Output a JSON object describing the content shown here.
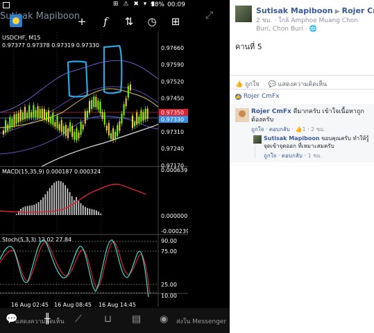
{
  "status_bar": {
    "time": "00:09",
    "battery": "98%",
    "icons": "⊞ ⚠ ✖ ▾ ▮"
  },
  "toolbar": {
    "account_name": "Sutisak Mapiboon",
    "tool_crosshair": "+",
    "tool_indicator": "f",
    "tool_objects": "⇅",
    "tool_timeframe": "◷",
    "tool_new_order": "⊞"
  },
  "chart": {
    "price_panel": {
      "symbol_label": "USDCHF, M15",
      "ohlc_label": "0.97377 0.97378 0.97319 0.97330",
      "price_ticks": [
        "0.97660",
        "0.97590",
        "0.97520",
        "0.97450",
        "0.97380",
        "0.97310",
        "0.97240",
        "0.97170"
      ],
      "current_price_red": "0.97350",
      "current_price_blue": "0.97330"
    },
    "macd_panel": {
      "label": "MACD(15,35,9) 0.000187 0.000324",
      "ticks": [
        "0.000639",
        "0.000000",
        "-0.000239"
      ]
    },
    "stoch_panel": {
      "label": "Stoch(5,3,3) 12.02 27.84",
      "ticks": [
        "90.00",
        "75.00",
        "25.00",
        "10.00"
      ]
    },
    "time_labels": [
      "16 Aug 02:45",
      "16 Aug 08:45",
      "16 Aug 14:45"
    ]
  },
  "bottom_bar": {
    "trade_label": "แสดงความคิดเห็น",
    "share_label": "ส่งใน Messenger",
    "icons": [
      "chat-icon",
      "chart-icon",
      "inbox-icon",
      "history-icon",
      "settings-icon"
    ]
  },
  "facebook": {
    "poster": "Sutisak Mapiboon",
    "target": "Rojer CmFx",
    "meta": "2 ชม. · ใกล้ Amphoe Muang Chon Buri, Chon Buri · 🌐",
    "post_text": "คานที่ 5",
    "actions": {
      "like": "👍 ถูกใจ",
      "comment": "💬 แสดงความคิดเห็น"
    },
    "reactor": "Rojer CmFx",
    "comment": {
      "name": "Rojer CmFx",
      "text": "ดีมากครับ เข้าใจเนื้อหาถูกต้องครับ",
      "like": "ถูกใจ",
      "reply": "ตอบกลับ",
      "likes": "1",
      "time": "2 ชม."
    },
    "reply": {
      "name": "Sutisak Mapiboon",
      "text": "ขอบคุณครับ ทำให้รู้จุดเข้าจุดออก ที่เหมาะสมครับ",
      "like": "ถูกใจ",
      "reply": "ตอบกลับ",
      "time": "1 ชม."
    }
  }
}
